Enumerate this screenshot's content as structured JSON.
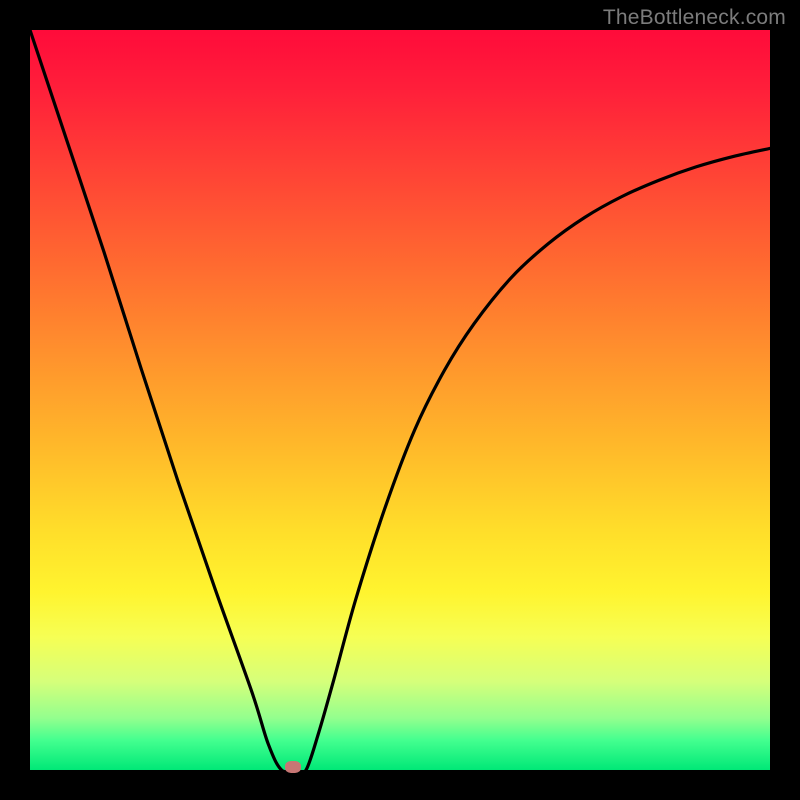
{
  "watermark": "TheBottleneck.com",
  "chart_data": {
    "type": "line",
    "title": "",
    "xlabel": "",
    "ylabel": "",
    "xlim": [
      0,
      1
    ],
    "ylim": [
      0,
      1
    ],
    "series": [
      {
        "name": "bottleneck-curve",
        "x": [
          0.0,
          0.05,
          0.1,
          0.15,
          0.2,
          0.25,
          0.3,
          0.322,
          0.34,
          0.36,
          0.373,
          0.39,
          0.41,
          0.44,
          0.48,
          0.52,
          0.56,
          0.6,
          0.65,
          0.7,
          0.75,
          0.8,
          0.85,
          0.9,
          0.95,
          1.0
        ],
        "values": [
          1.0,
          0.85,
          0.7,
          0.543,
          0.39,
          0.245,
          0.105,
          0.035,
          0.0,
          0.0,
          0.0,
          0.05,
          0.12,
          0.23,
          0.355,
          0.46,
          0.54,
          0.603,
          0.665,
          0.711,
          0.747,
          0.775,
          0.797,
          0.815,
          0.829,
          0.84
        ]
      }
    ],
    "marker": {
      "x": 0.355,
      "y": 0.004,
      "color": "#c77674"
    },
    "background_gradient": {
      "top": "#ff0b3a",
      "mid": "#ffdf2a",
      "bottom": "#00e877"
    },
    "curve_color": "#000000"
  }
}
